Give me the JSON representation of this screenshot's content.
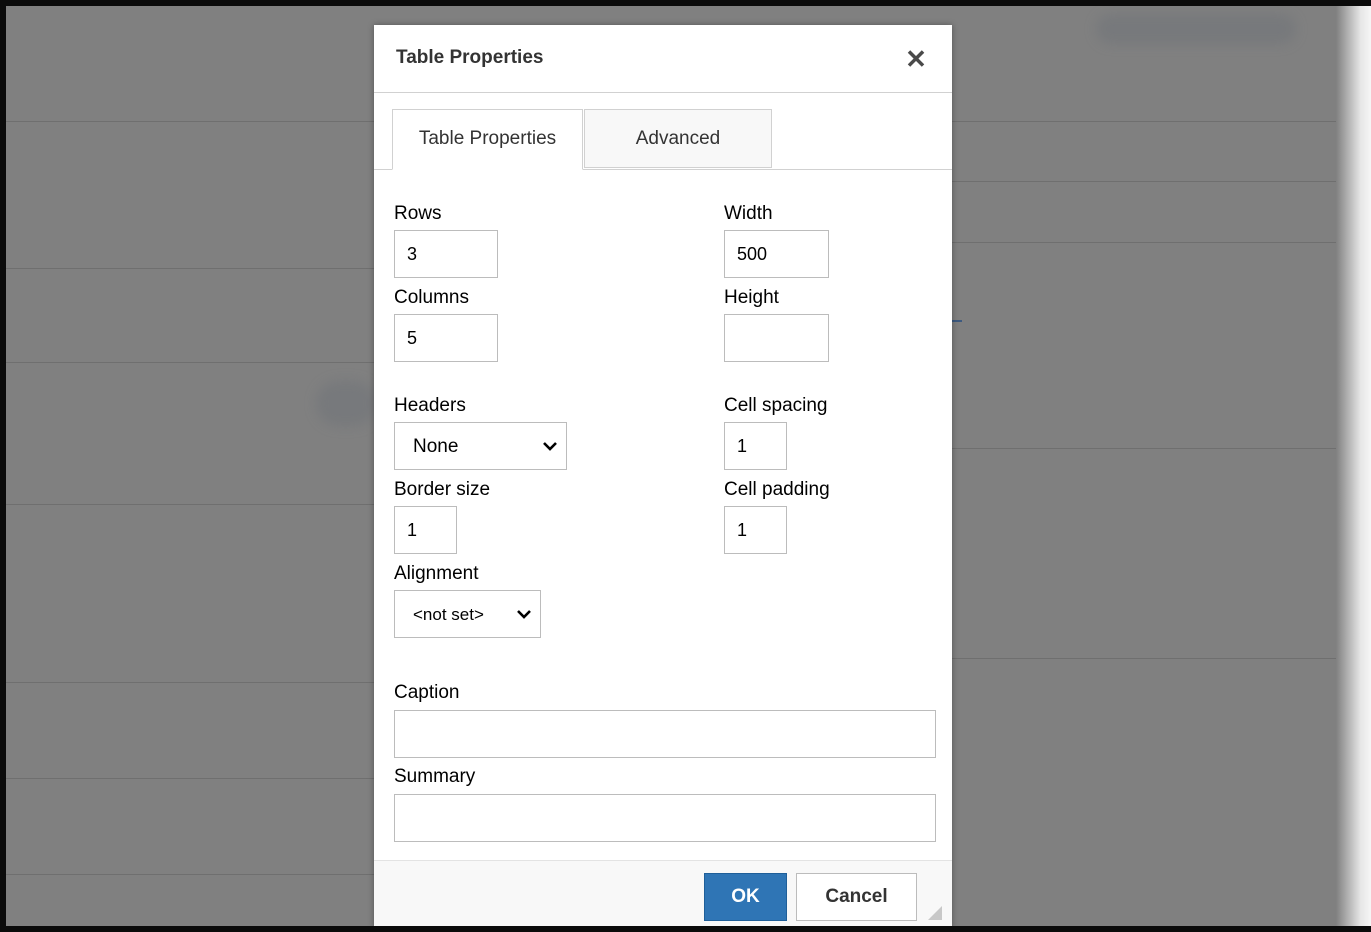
{
  "dialog": {
    "title": "Table Properties",
    "close_symbol": "✕",
    "tabs": [
      {
        "label": "Table Properties",
        "active": true
      },
      {
        "label": "Advanced",
        "active": false
      }
    ]
  },
  "form": {
    "rows": {
      "label": "Rows",
      "value": "3"
    },
    "columns": {
      "label": "Columns",
      "value": "5"
    },
    "width": {
      "label": "Width",
      "value": "500"
    },
    "height": {
      "label": "Height",
      "value": ""
    },
    "headers": {
      "label": "Headers",
      "value": "None"
    },
    "cell_spacing": {
      "label": "Cell spacing",
      "value": "1"
    },
    "border_size": {
      "label": "Border size",
      "value": "1"
    },
    "cell_padding": {
      "label": "Cell padding",
      "value": "1"
    },
    "alignment": {
      "label": "Alignment",
      "value": "<not set>"
    },
    "caption": {
      "label": "Caption",
      "value": ""
    },
    "summary": {
      "label": "Summary",
      "value": ""
    }
  },
  "footer": {
    "ok_label": "OK",
    "cancel_label": "Cancel"
  },
  "colors": {
    "accent": "#2f75b5",
    "overlay": "#808080"
  },
  "icons": {
    "close": "close-icon",
    "dropdown": "chevron-down-icon",
    "resize": "resize-grip-icon"
  }
}
